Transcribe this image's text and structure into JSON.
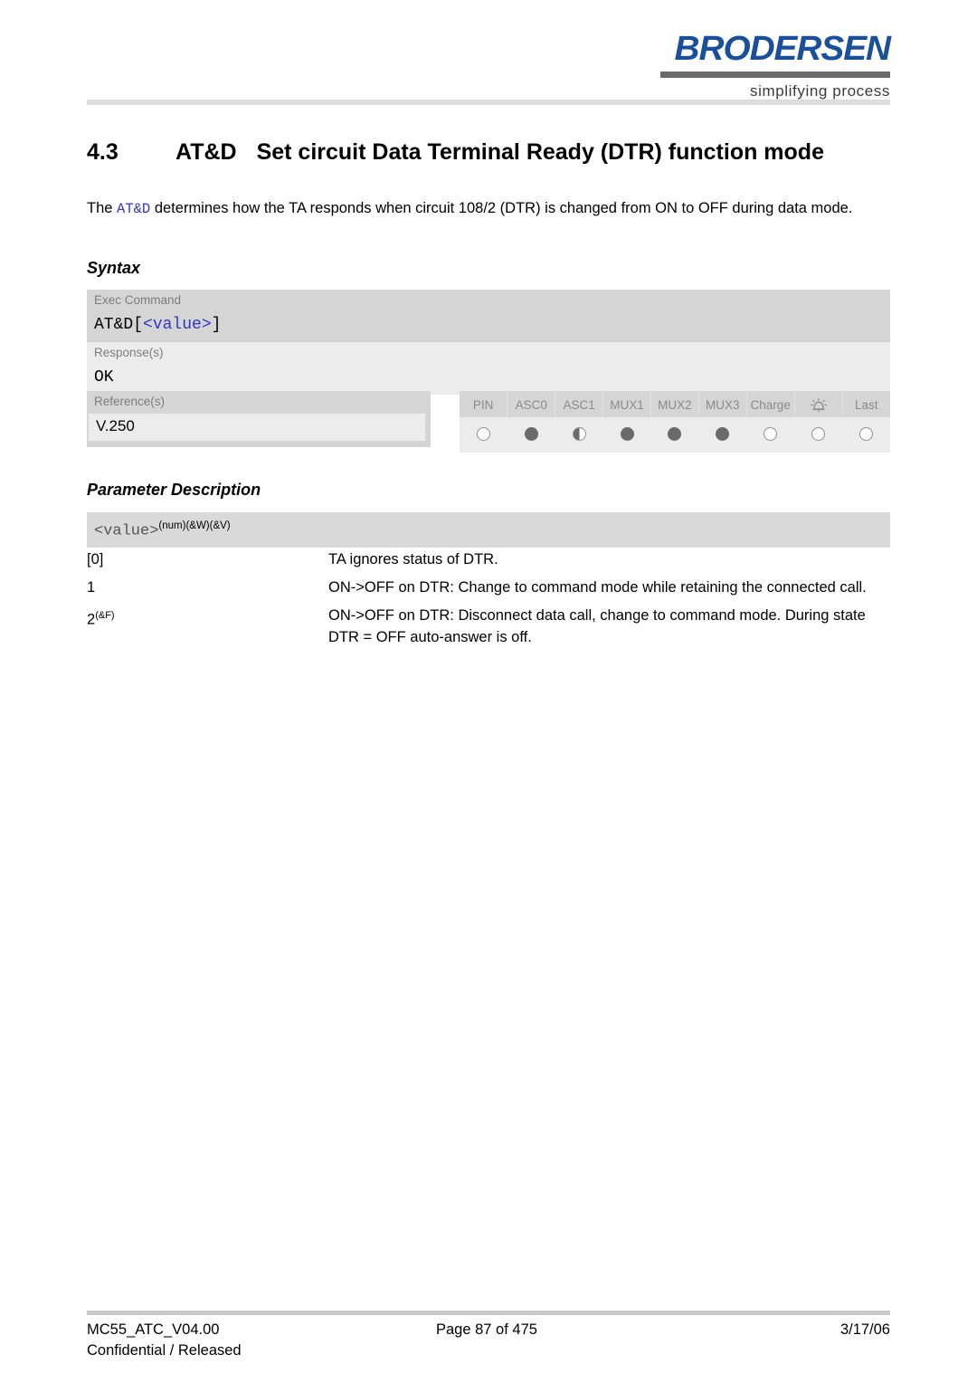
{
  "brand": {
    "name": "BRODERSEN",
    "tagline": "simplifying process",
    "color": "#1a4f9c",
    "bar_color": "#6b6b6b"
  },
  "title": {
    "number": "4.3",
    "command": "AT&D",
    "text": "Set circuit Data Terminal Ready (DTR) function mode"
  },
  "intro": {
    "before": "The ",
    "command": "AT&D",
    "after": " determines how the TA responds when circuit 108/2 (DTR) is changed from ON to OFF during data mode."
  },
  "sections": {
    "syntax_heading": "Syntax",
    "parameter_heading": "Parameter Description"
  },
  "syntax": {
    "exec_label": "Exec Command",
    "exec_value_prefix": "AT&D[",
    "exec_value_param": "<value>",
    "exec_value_suffix": "]",
    "response_label": "Response(s)",
    "response_value": "OK",
    "reference_label": "Reference(s)",
    "reference_value": "V.250"
  },
  "indicators": {
    "columns": [
      {
        "label": "PIN",
        "state": "empty",
        "icon": null
      },
      {
        "label": "ASC0",
        "state": "full",
        "icon": null
      },
      {
        "label": "ASC1",
        "state": "half",
        "icon": null
      },
      {
        "label": "MUX1",
        "state": "full",
        "icon": null
      },
      {
        "label": "MUX2",
        "state": "full",
        "icon": null
      },
      {
        "label": "MUX3",
        "state": "full",
        "icon": null
      },
      {
        "label": "Charge",
        "state": "empty",
        "icon": null
      },
      {
        "label": "",
        "state": "empty",
        "icon": "alarm-bell-icon"
      },
      {
        "label": "Last",
        "state": "empty",
        "icon": null
      }
    ]
  },
  "parameter": {
    "name": "<value>",
    "superscript": "(num)(&W)(&V)",
    "rows": [
      {
        "key": "[0]",
        "key_sup": "",
        "description": "TA ignores status of DTR."
      },
      {
        "key": "1",
        "key_sup": "",
        "description": "ON->OFF on DTR: Change to command mode while retaining the connected call."
      },
      {
        "key": "2",
        "key_sup": "(&F)",
        "description": "ON->OFF on DTR: Disconnect data call, change to command mode. During state DTR = OFF auto-answer is off."
      }
    ]
  },
  "footer": {
    "document": "MC55_ATC_V04.00",
    "classification": "Confidential / Released",
    "page": "Page 87 of 475",
    "date": "3/17/06"
  }
}
